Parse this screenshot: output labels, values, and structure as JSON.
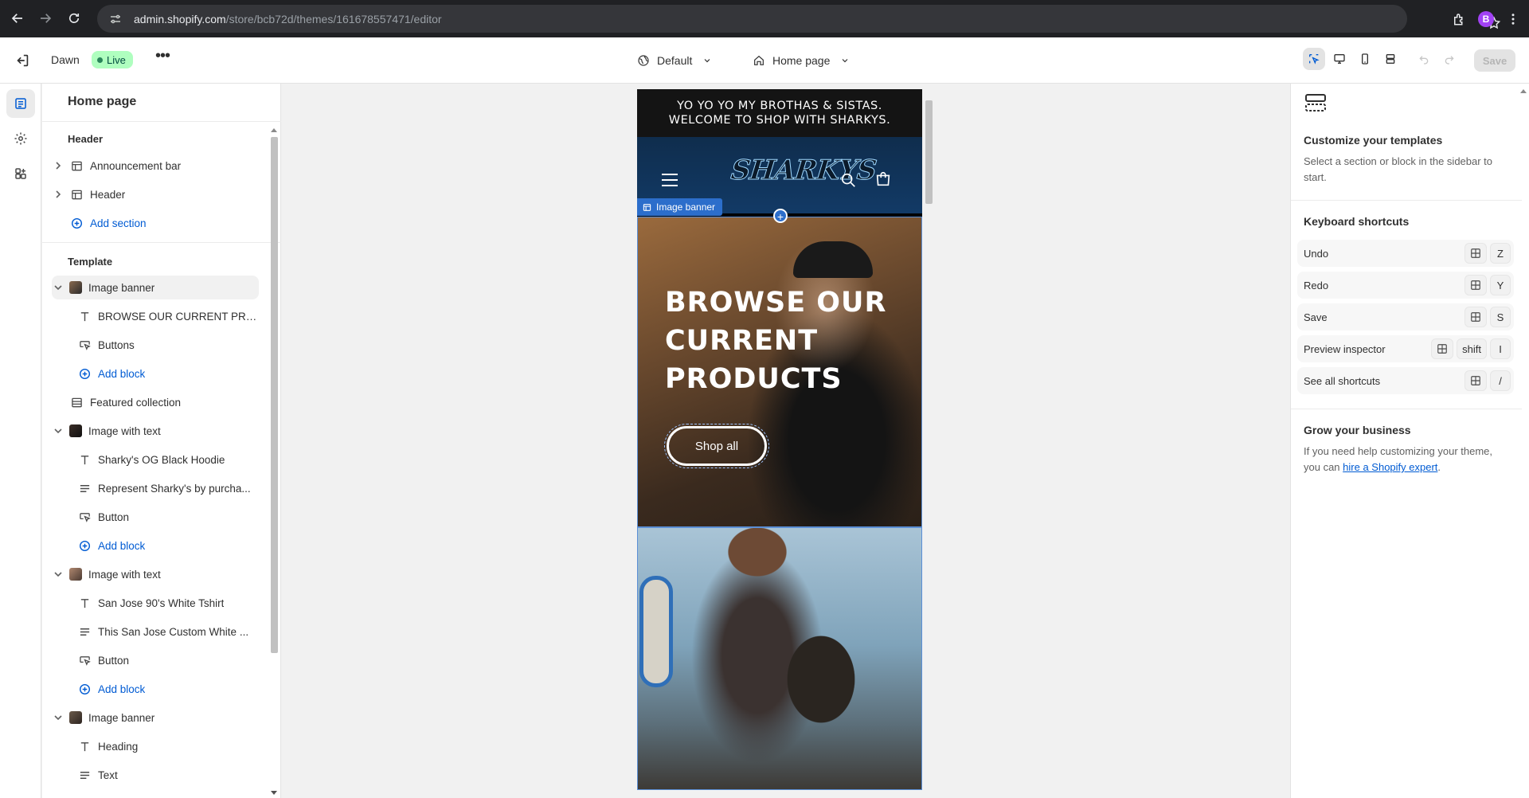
{
  "browser": {
    "url_host": "admin.shopify.com",
    "url_path": "/store/bcb72d/themes/161678557471/editor",
    "profile_initial": "B"
  },
  "topbar": {
    "theme_name": "Dawn",
    "status_badge": "Live",
    "context_label": "Default",
    "page_label": "Home page",
    "save_label": "Save"
  },
  "sidebar": {
    "title": "Home page",
    "header_group": "Header",
    "header_items": [
      {
        "label": "Announcement bar"
      },
      {
        "label": "Header"
      }
    ],
    "add_section": "Add section",
    "template_group": "Template",
    "template_items": [
      {
        "label": "Image banner",
        "kind": "section"
      },
      {
        "label": "BROWSE OUR CURRENT PRO...",
        "kind": "text"
      },
      {
        "label": "Buttons",
        "kind": "button"
      },
      {
        "label": "Add block",
        "kind": "add"
      },
      {
        "label": "Featured collection",
        "kind": "section"
      },
      {
        "label": "Image with text",
        "kind": "section"
      },
      {
        "label": "Sharky's OG Black Hoodie",
        "kind": "text"
      },
      {
        "label": "Represent Sharky's by purcha...",
        "kind": "paragraph"
      },
      {
        "label": "Button",
        "kind": "button"
      },
      {
        "label": "Add block",
        "kind": "add"
      },
      {
        "label": "Image with text",
        "kind": "section"
      },
      {
        "label": "San Jose 90's White Tshirt",
        "kind": "text"
      },
      {
        "label": "This San Jose Custom White ...",
        "kind": "paragraph"
      },
      {
        "label": "Button",
        "kind": "button"
      },
      {
        "label": "Add block",
        "kind": "add"
      },
      {
        "label": "Image banner",
        "kind": "section"
      },
      {
        "label": "Heading",
        "kind": "text"
      },
      {
        "label": "Text",
        "kind": "paragraph"
      }
    ]
  },
  "preview": {
    "announcement_line1": "YO YO YO MY BROTHAS & SISTAS.",
    "announcement_line2": "WELCOME TO SHOP WITH SHARKYS.",
    "logo_text": "SHARKYS",
    "section_chip": "Image banner",
    "banner_heading": "BROWSE OUR CURRENT PRODUCTS",
    "banner_button": "Shop all"
  },
  "right_panel": {
    "customize_title": "Customize your templates",
    "customize_text": "Select a section or block in the sidebar to start.",
    "shortcuts_title": "Keyboard shortcuts",
    "shortcuts": [
      {
        "label": "Undo",
        "keys": [
          "Z"
        ]
      },
      {
        "label": "Redo",
        "keys": [
          "Y"
        ]
      },
      {
        "label": "Save",
        "keys": [
          "S"
        ]
      },
      {
        "label": "Preview inspector",
        "keys": [
          "shift",
          "I"
        ]
      },
      {
        "label": "See all shortcuts",
        "keys": [
          "/"
        ]
      }
    ],
    "grow_title": "Grow your business",
    "grow_text_before": "If you need help customizing your theme, you can ",
    "grow_link": "hire a Shopify expert",
    "grow_text_after": "."
  },
  "colors": {
    "accent": "#005bd3",
    "live_badge_bg": "#affebf",
    "announcement_bg": "#141414",
    "store_header_bg": "#123a66"
  }
}
